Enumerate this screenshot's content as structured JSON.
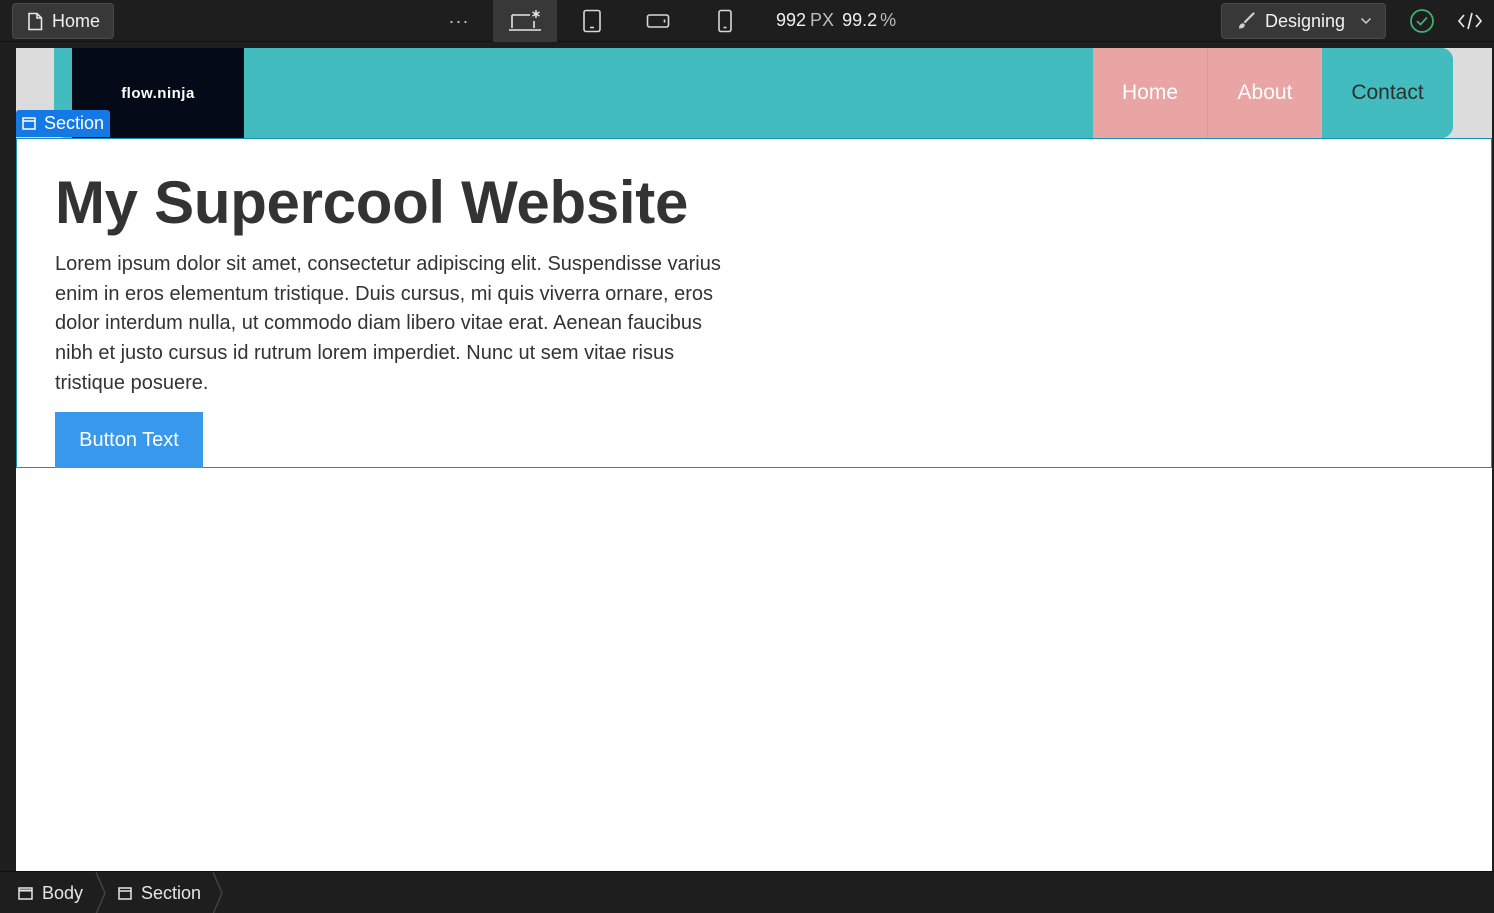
{
  "toolbar": {
    "page_label": "Home",
    "more_icon": "ellipsis-icon",
    "breakpoints": [
      {
        "icon": "desktop-base-icon",
        "active": true
      },
      {
        "icon": "tablet-icon",
        "active": false
      },
      {
        "icon": "mobile-landscape-icon",
        "active": false
      },
      {
        "icon": "mobile-portrait-icon",
        "active": false
      }
    ],
    "width_value": "992",
    "width_unit": "PX",
    "zoom_value": "99.2",
    "zoom_unit": "%",
    "mode_label": "Designing",
    "status_color": "#3cb371"
  },
  "site": {
    "brand": "flow.ninja",
    "nav": {
      "home": "Home",
      "about": "About",
      "contact": "Contact"
    },
    "colors": {
      "navbar": "#42bcbe",
      "nav_highlight": "#e9a4a4",
      "brand_bg": "#040a17",
      "button": "#3898ec"
    }
  },
  "selection": {
    "badge_label": "Section"
  },
  "hero": {
    "title": "My Supercool Website",
    "body": "Lorem ipsum dolor sit amet, consectetur adipiscing elit. Suspendisse varius enim in eros elementum tristique. Duis cursus, mi quis viverra ornare, eros dolor interdum nulla, ut commodo diam libero vitae erat. Aenean faucibus nibh et justo cursus id rutrum lorem imperdiet. Nunc ut sem vitae risus tristique posuere.",
    "button": "Button Text"
  },
  "breadcrumb": {
    "items": [
      {
        "label": "Body",
        "icon": "body-element-icon"
      },
      {
        "label": "Section",
        "icon": "section-element-icon"
      }
    ]
  }
}
